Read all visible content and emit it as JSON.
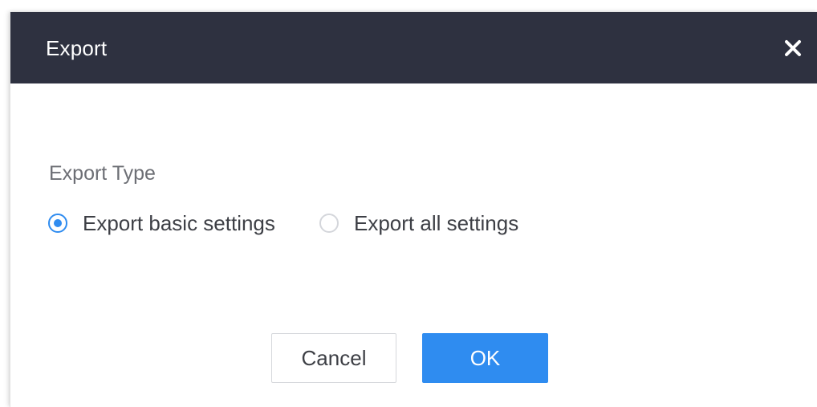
{
  "dialog": {
    "title": "Export",
    "close_icon": "close-icon"
  },
  "export_type": {
    "label": "Export Type",
    "options": [
      {
        "label": "Export basic settings",
        "selected": true
      },
      {
        "label": "Export all settings",
        "selected": false
      }
    ]
  },
  "buttons": {
    "cancel_label": "Cancel",
    "ok_label": "OK"
  },
  "colors": {
    "header_bg": "#2e3140",
    "accent": "#2f8cf0",
    "label_text": "#6d6f75",
    "body_text": "#3d3f45"
  }
}
